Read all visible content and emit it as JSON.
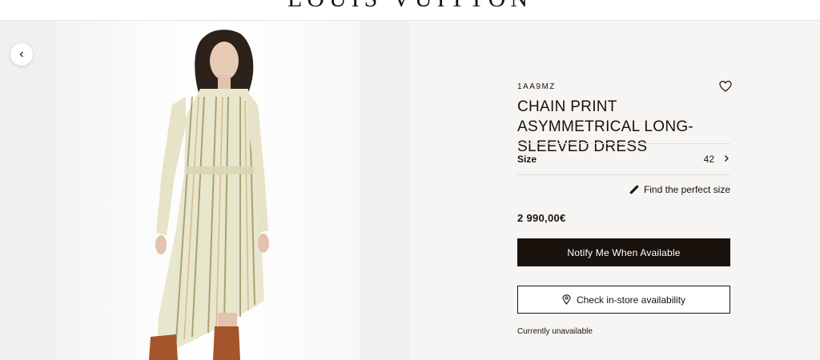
{
  "header": {
    "logo_text": "LOUIS VUITTON"
  },
  "gallery": {
    "prev_icon": "chevron-left-icon"
  },
  "product": {
    "reference": "1AA9MZ",
    "title": "CHAIN PRINT ASYMMETRICAL LONG-SLEEVED DRESS",
    "wishlist_icon": "heart-icon",
    "size_label": "Size",
    "size_value": "42",
    "find_size_label": "Find the perfect size",
    "price": "2 990,00€",
    "notify_label": "Notify Me When Available",
    "store_label": "Check in-store availability",
    "availability": "Currently unavailable"
  },
  "colors": {
    "primary": "#19110b",
    "panel_bg": "#f6f5f3",
    "boot": "#a4552b",
    "dress": "#e8e6cc"
  }
}
